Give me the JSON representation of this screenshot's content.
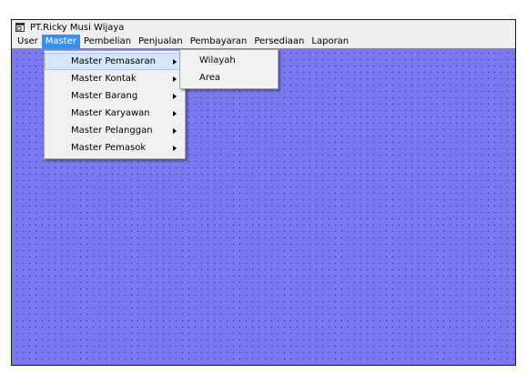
{
  "window": {
    "title": "PT.Ricky Musi Wijaya"
  },
  "menubar": {
    "items": [
      {
        "label": "User"
      },
      {
        "label": "Master"
      },
      {
        "label": "Pembelian"
      },
      {
        "label": "Penjualan"
      },
      {
        "label": "Pembayaran"
      },
      {
        "label": "Persediaan"
      },
      {
        "label": "Laporan"
      }
    ]
  },
  "master_menu": {
    "items": [
      {
        "label": "Master Pemasaran"
      },
      {
        "label": "Master Kontak"
      },
      {
        "label": "Master Barang"
      },
      {
        "label": "Master Karyawan"
      },
      {
        "label": "Master Pelanggan"
      },
      {
        "label": "Master Pemasok"
      }
    ]
  },
  "pemasaran_submenu": {
    "items": [
      {
        "label": "Wilayah"
      },
      {
        "label": "Area"
      }
    ]
  },
  "colors": {
    "client_background": "#7b79ee",
    "menu_highlight": "#3b91e8"
  },
  "icons": {
    "app": "app-window-icon",
    "submenu": "submenu-arrow-icon"
  }
}
